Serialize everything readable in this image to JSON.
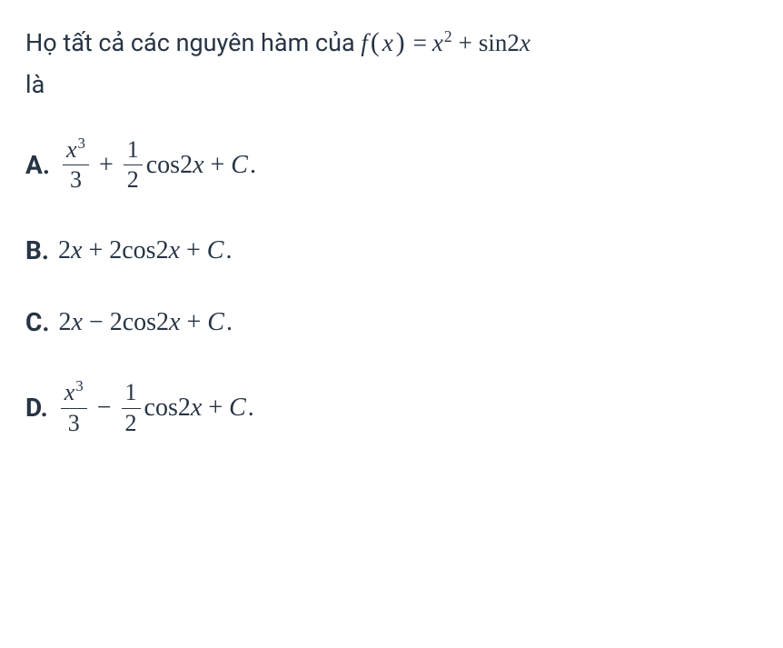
{
  "question": {
    "prefix": "Họ tất cả các nguyên hàm của ",
    "suffix": "là"
  },
  "function": {
    "f_letter": "f",
    "lparen": "(",
    "var": "x",
    "rparen": ")",
    "eq": "=",
    "x": "x",
    "exp": "2",
    "plus": "+",
    "sin": "sin",
    "two": "2",
    "x2": "x"
  },
  "options": {
    "a": {
      "label": "A.",
      "frac1_num_x": "x",
      "frac1_num_exp": "3",
      "frac1_den": "3",
      "plus": "+",
      "frac2_num": "1",
      "frac2_den": "2",
      "cos": "cos",
      "two": "2",
      "x": "x",
      "plus2": "+",
      "c": "C",
      "period": "."
    },
    "b": {
      "label": "B.",
      "two1": "2",
      "x1": "x",
      "plus1": "+",
      "two2": "2",
      "cos": "cos",
      "two3": "2",
      "x2": "x",
      "plus2": "+",
      "c": "C",
      "period": "."
    },
    "c": {
      "label": "C.",
      "two1": "2",
      "x1": "x",
      "minus": "−",
      "two2": "2",
      "cos": "cos",
      "two3": "2",
      "x2": "x",
      "plus2": "+",
      "c": "C",
      "period": "."
    },
    "d": {
      "label": "D.",
      "frac1_num_x": "x",
      "frac1_num_exp": "3",
      "frac1_den": "3",
      "minus": "−",
      "frac2_num": "1",
      "frac2_den": "2",
      "cos": "cos",
      "two": "2",
      "x": "x",
      "plus2": "+",
      "c": "C",
      "period": "."
    }
  }
}
